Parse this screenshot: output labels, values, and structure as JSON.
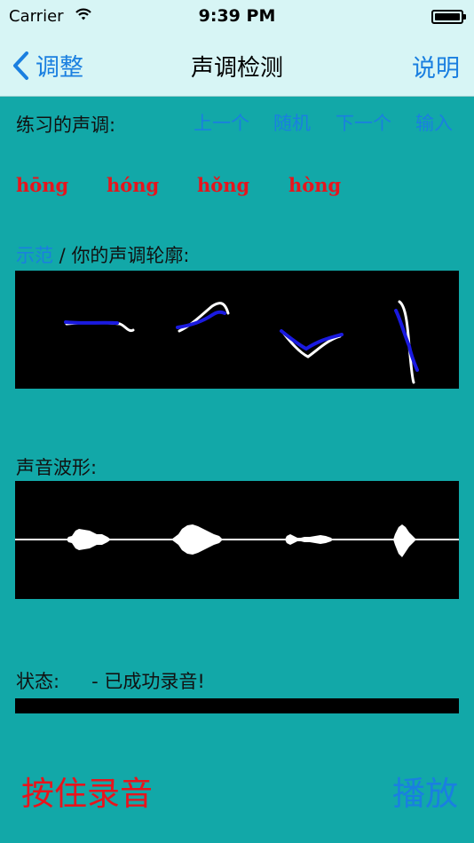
{
  "status_bar": {
    "carrier": "Carrier",
    "time": "9:39 PM",
    "battery_level": 1.0
  },
  "nav": {
    "back_label": "调整",
    "title": "声调检测",
    "help_label": "说明"
  },
  "practice": {
    "label": "练习的声调:",
    "buttons": [
      "上一个",
      "随机",
      "下一个",
      "输入"
    ],
    "syllables": [
      "hōng",
      "hóng",
      "hǒng",
      "hòng"
    ]
  },
  "contour": {
    "demo_label": "示范",
    "separator": " / ",
    "yours_label": "你的声调轮廓:"
  },
  "waveform": {
    "label": "声音波形:"
  },
  "status": {
    "label": "状态:",
    "value": "- 已成功录音!"
  },
  "progress": {
    "value": 1.0
  },
  "actions": {
    "record_label": "按住录音",
    "play_label": "播放"
  },
  "colors": {
    "background": "#12a8a8",
    "nav_background": "#d7f5f5",
    "accent_blue": "#1a7fe0",
    "syllable_red": "#e8141c",
    "panel_black": "#000000",
    "demo_curve": "#ffffff",
    "user_curve": "#1a1ae0"
  }
}
